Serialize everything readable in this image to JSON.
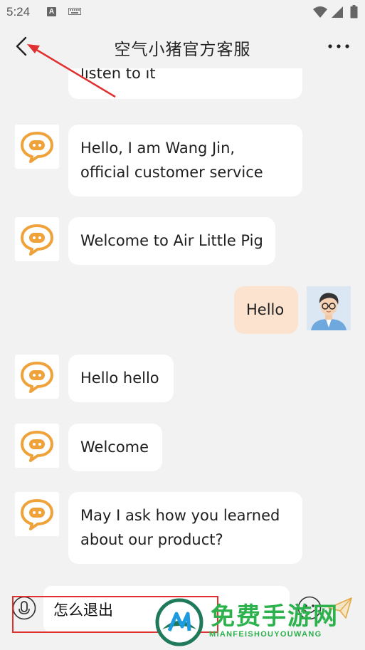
{
  "status_bar": {
    "time": "5:24",
    "notification_icon_letter": "A"
  },
  "header": {
    "title": "空气小猪官方客服",
    "back_icon": "chevron-left-icon",
    "more_icon": "more-dots-icon"
  },
  "messages": [
    {
      "sender": "agent",
      "lines": [
        "listen to it"
      ]
    },
    {
      "sender": "agent",
      "lines": [
        "Hello, I am Wang Jin,",
        "official customer service"
      ]
    },
    {
      "sender": "agent",
      "lines": [
        "Welcome to Air Little Pig"
      ]
    },
    {
      "sender": "user",
      "lines": [
        "Hello"
      ]
    },
    {
      "sender": "agent",
      "lines": [
        "Hello hello"
      ]
    },
    {
      "sender": "agent",
      "lines": [
        "Welcome"
      ]
    },
    {
      "sender": "agent",
      "lines": [
        "May I ask how you learned",
        "about our product?"
      ]
    }
  ],
  "input_bar": {
    "value": "怎么退出",
    "voice_icon": "microphone-icon",
    "emoji_icon": "emoji-icon",
    "send_icon": "send-icon"
  },
  "watermark": {
    "title": "免费手游网",
    "subtitle": "MIANFEISHOUYOUWANG"
  },
  "colors": {
    "background": "#f2f2f2",
    "agent_bubble": "#ffffff",
    "user_bubble": "#fbe3cf",
    "agent_icon": "#f0a23a",
    "annotation": "#e03030",
    "watermark": "#2bb24c"
  }
}
